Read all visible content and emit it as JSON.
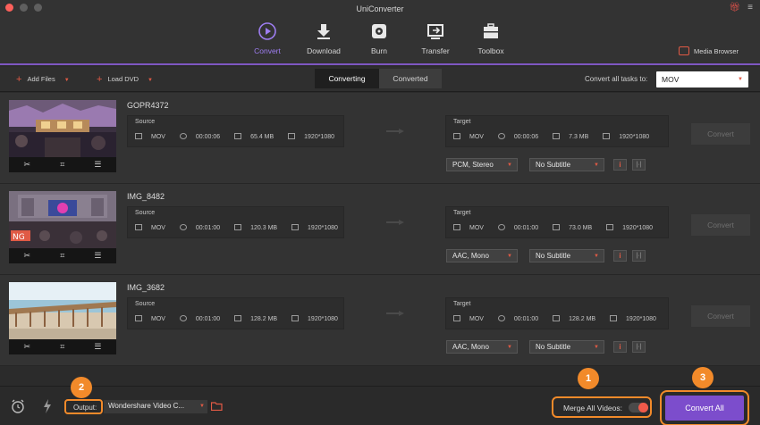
{
  "window": {
    "title": "UniConverter"
  },
  "nav": {
    "items": [
      {
        "label": "Convert",
        "icon": "convert-icon",
        "active": true
      },
      {
        "label": "Download",
        "icon": "download-icon"
      },
      {
        "label": "Burn",
        "icon": "burn-icon"
      },
      {
        "label": "Transfer",
        "icon": "transfer-icon"
      },
      {
        "label": "Toolbox",
        "icon": "toolbox-icon"
      }
    ],
    "media_browser": "Media Browser"
  },
  "toolbar": {
    "add_files": "Add Files",
    "load_dvd": "Load DVD",
    "tabs": [
      {
        "label": "Converting",
        "active": true
      },
      {
        "label": "Converted"
      }
    ],
    "convert_all_to_label": "Convert all tasks to:",
    "format": "MOV"
  },
  "files": [
    {
      "name": "GOPR4372",
      "source": {
        "title": "Source",
        "format": "MOV",
        "duration": "00:00:06",
        "size": "65.4 MB",
        "resolution": "1920*1080"
      },
      "target": {
        "title": "Target",
        "format": "MOV",
        "duration": "00:00:06",
        "size": "7.3 MB",
        "resolution": "1920*1080"
      },
      "audio": "PCM, Stereo",
      "subtitle": "No Subtitle",
      "convert_label": "Convert"
    },
    {
      "name": "IMG_8482",
      "source": {
        "title": "Source",
        "format": "MOV",
        "duration": "00:01:00",
        "size": "120.3 MB",
        "resolution": "1920*1080"
      },
      "target": {
        "title": "Target",
        "format": "MOV",
        "duration": "00:01:00",
        "size": "73.0 MB",
        "resolution": "1920*1080"
      },
      "audio": "AAC, Mono",
      "subtitle": "No Subtitle",
      "convert_label": "Convert"
    },
    {
      "name": "IMG_3682",
      "source": {
        "title": "Source",
        "format": "MOV",
        "duration": "00:01:00",
        "size": "128.2 MB",
        "resolution": "1920*1080"
      },
      "target": {
        "title": "Target",
        "format": "MOV",
        "duration": "00:01:00",
        "size": "128.2 MB",
        "resolution": "1920*1080"
      },
      "audio": "AAC, Mono",
      "subtitle": "No Subtitle",
      "convert_label": "Convert"
    }
  ],
  "bottom": {
    "output_label": "Output:",
    "output_path": "Wondershare Video C...",
    "merge_label": "Merge All Videos:",
    "merge_on": true,
    "convert_all": "Convert All"
  },
  "callouts": [
    "1",
    "2",
    "3"
  ],
  "colors": {
    "accent": "#7c4dcc",
    "highlight": "#f28a2a",
    "icon_red": "#e05a45"
  }
}
